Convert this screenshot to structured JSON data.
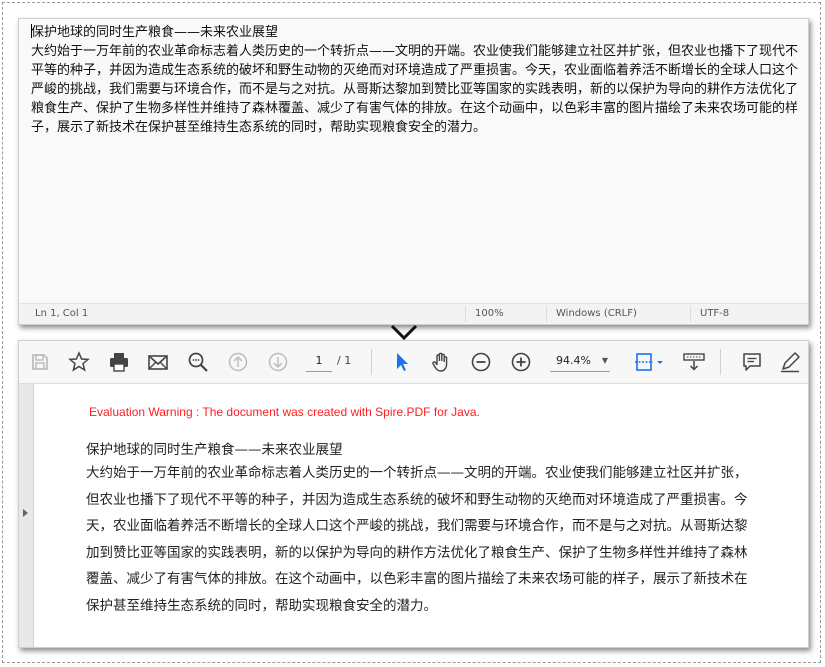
{
  "notepad": {
    "title_line": "保护地球的同时生产粮食——未来农业展望",
    "body": "大约始于一万年前的农业革命标志着人类历史的一个转折点——文明的开端。农业使我们能够建立社区并扩张，但农业也播下了现代不平等的种子，并因为造成生态系统的破坏和野生动物的灭绝而对环境造成了严重损害。今天，农业面临着养活不断增长的全球人口这个严峻的挑战，我们需要与环境合作，而不是与之对抗。从哥斯达黎加到赞比亚等国家的实践表明，新的以保护为导向的耕作方法优化了粮食生产、保护了生物多样性并维持了森林覆盖、减少了有害气体的排放。在这个动画中，以色彩丰富的图片描绘了未来农场可能的样子，展示了新技术在保护甚至维持生态系统的同时，帮助实现粮食安全的潜力。",
    "status": {
      "position": "Ln 1, Col 1",
      "zoom": "100%",
      "line_ending": "Windows (CRLF)",
      "encoding": "UTF-8"
    }
  },
  "reader": {
    "toolbar": {
      "page_current": "1",
      "page_total": "/ 1",
      "zoom": "94.4%"
    },
    "document": {
      "warning": "Evaluation Warning : The document was created with Spire.PDF for Java.",
      "title": "保护地球的同时生产粮食——未来农业展望",
      "body": "大约始于一万年前的农业革命标志着人类历史的一个转折点——文明的开端。农业使我们能够建立社区并扩张，但农业也播下了现代不平等的种子，并因为造成生态系统的破坏和野生动物的灭绝而对环境造成了严重损害。今天，农业面临着养活不断增长的全球人口这个严峻的挑战，我们需要与环境合作，而不是与之对抗。从哥斯达黎加到赞比亚等国家的实践表明，新的以保护为导向的耕作方法优化了粮食生产、保护了生物多样性并维持了森林覆盖、减少了有害气体的排放。在这个动画中，以色彩丰富的图片描绘了未来农场可能的样子，展示了新技术在保护甚至维持生态系统的同时，帮助实现粮食安全的潜力。"
    }
  },
  "colors": {
    "warning": "#ff1f1f",
    "accent": "#1a73e8"
  }
}
